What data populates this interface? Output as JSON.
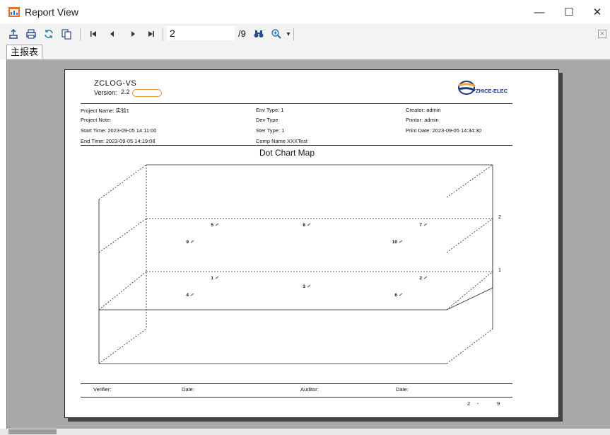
{
  "window": {
    "title": "Report View",
    "controls": {
      "minimize": "—",
      "maximize": "☐",
      "close": "✕"
    }
  },
  "toolbar": {
    "icons": [
      "export-icon",
      "print-icon",
      "refresh-icon",
      "page-setup-icon",
      "first-page-icon",
      "prev-page-icon",
      "next-page-icon",
      "last-page-icon",
      "find-icon",
      "zoom-icon"
    ],
    "page_value": "2",
    "page_total": "/9",
    "zoom_dropdown": "▾",
    "close_glyph": "✕"
  },
  "tabs": [
    {
      "label": "主报表"
    }
  ],
  "report": {
    "title": "ZCLOG-VS",
    "version_label": "Version:",
    "version_value": "2.2",
    "logo_text": "ZHICE-ELEC",
    "meta": {
      "project_name": "Project  Name:  实验1",
      "project_note": "Project  Note:",
      "start_time": "Start  Time:  2023-09-05  14:11:00",
      "end_time": "End  Time:  2023-09-05  14:19:08",
      "env_type": "Env  Type:  1",
      "dev_type": "Dev  Type",
      "ster_type": "Ster Type:  1",
      "comp_name": "Comp Name  XXXTest",
      "creator": "Creator:  admin",
      "printor": "Printor:  admin",
      "print_date": "Print Date:  2023-09-05 14:34:30"
    },
    "footer": {
      "verifier": "Verifier:",
      "date1": "Date:",
      "auditor": "Auditor:",
      "date2": "Date:",
      "page_current": "2",
      "page_dash": "-",
      "page_total": "9"
    }
  },
  "chart_data": {
    "type": "scatter",
    "title": "Dot Chart Map",
    "layer_labels": [
      "2",
      "1"
    ],
    "series": [
      {
        "name": "",
        "points": [
          {
            "label": "5",
            "layer": 2,
            "x": 1,
            "y": 2
          },
          {
            "label": "8",
            "layer": 2,
            "x": 2,
            "y": 2
          },
          {
            "label": "7",
            "layer": 2,
            "x": 3,
            "y": 2
          },
          {
            "label": "9",
            "layer": 2,
            "x": 1,
            "y": 1
          },
          {
            "label": "10",
            "layer": 2,
            "x": 3,
            "y": 1
          },
          {
            "label": "1",
            "layer": 1,
            "x": 1,
            "y": 2
          },
          {
            "label": "3",
            "layer": 1,
            "x": 2,
            "y": 1.5
          },
          {
            "label": "2",
            "layer": 1,
            "x": 3,
            "y": 2
          },
          {
            "label": "4",
            "layer": 1,
            "x": 1,
            "y": 1
          },
          {
            "label": "6",
            "layer": 1,
            "x": 3,
            "y": 1
          }
        ]
      }
    ],
    "colors": {
      "marker": "#3a9a3a",
      "lines": "#222222"
    }
  }
}
